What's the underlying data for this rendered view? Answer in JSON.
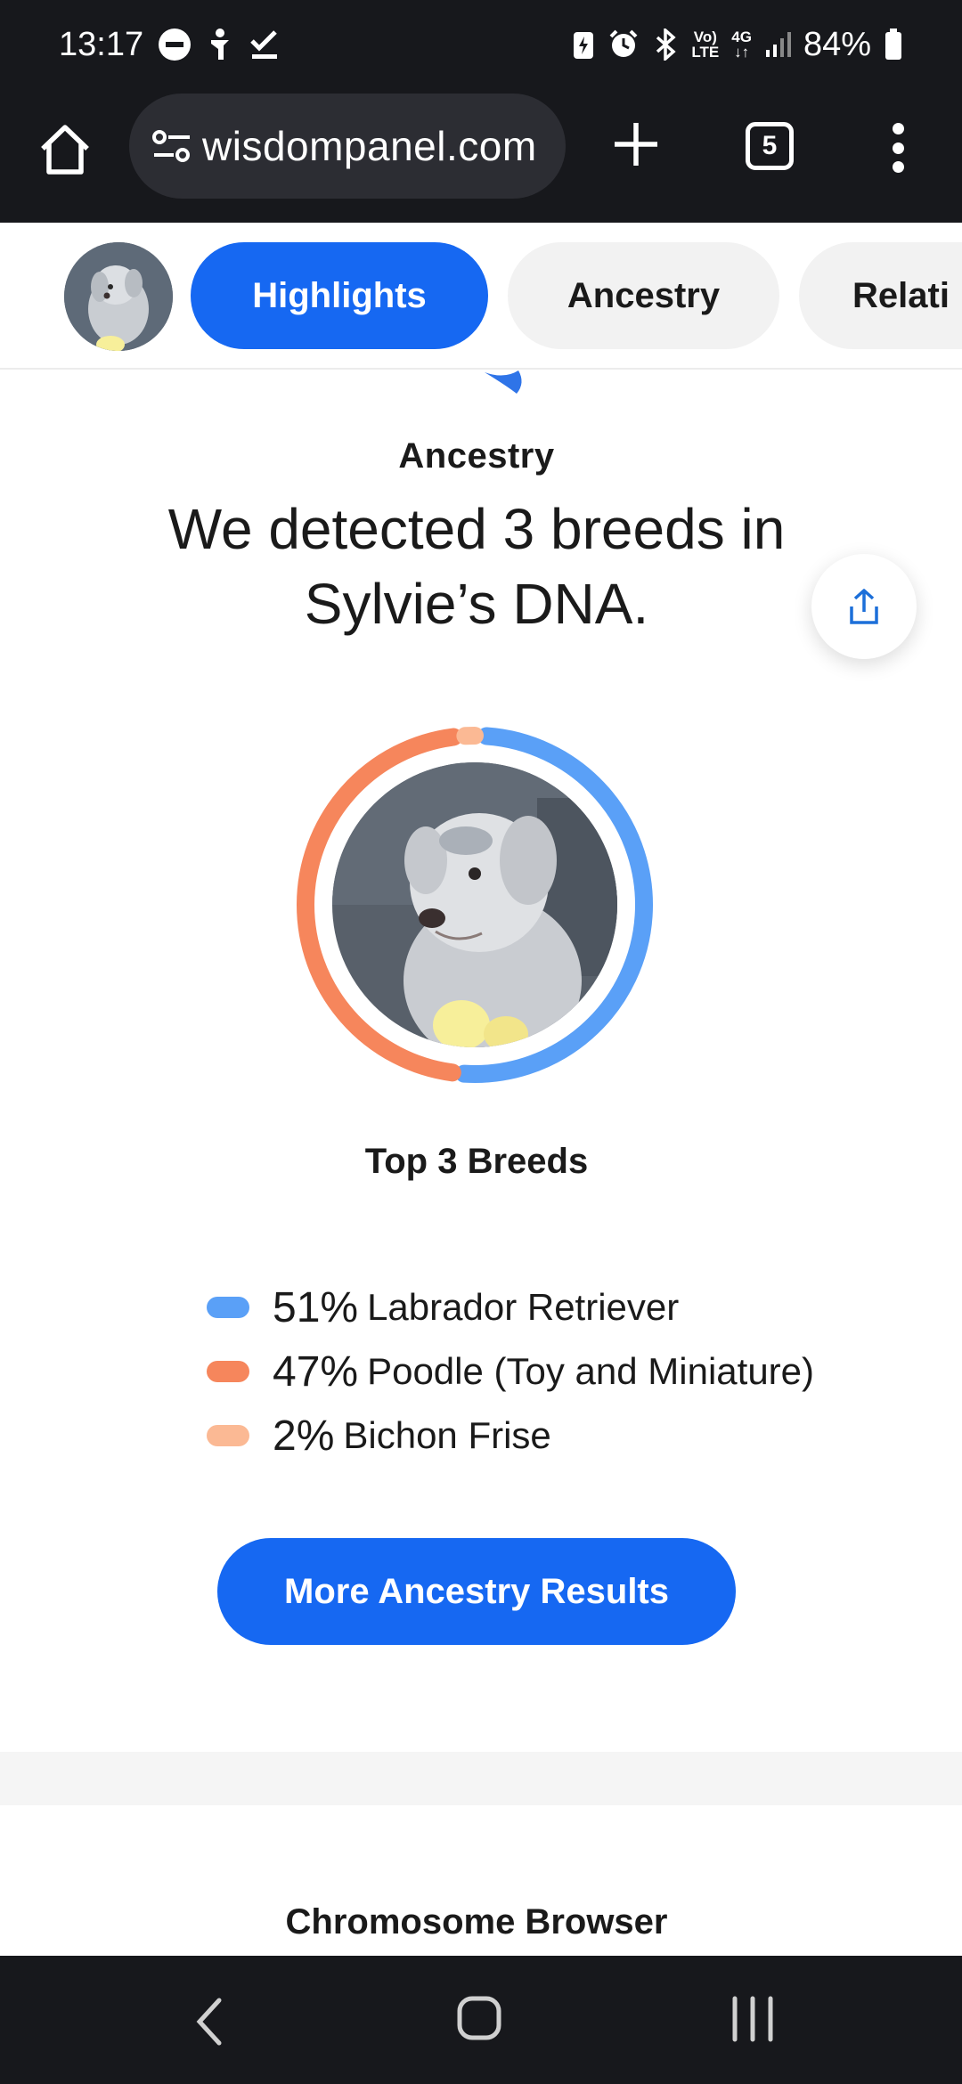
{
  "status_bar": {
    "time": "13:17",
    "battery": "84%",
    "network_top": "Vo)",
    "network_bottom": "LTE",
    "signal_top": "4G",
    "signal_bottom": "↓↑"
  },
  "browser": {
    "url": "wisdompanel.com",
    "tab_count": "5"
  },
  "tabs": [
    {
      "label": "Highlights",
      "active": true
    },
    {
      "label": "Ancestry",
      "active": false
    },
    {
      "label": "Relati",
      "active": false
    }
  ],
  "ancestry": {
    "section_label": "Ancestry",
    "headline_line1": "We detected 3 breeds in",
    "headline_line2": "Sylvie’s DNA.",
    "top_breeds_title": "Top 3 Breeds",
    "cta_label": "More Ancestry Results"
  },
  "chart_data": {
    "type": "pie",
    "variant": "donut",
    "title": "",
    "categories": [
      "Labrador Retriever",
      "Poodle (Toy and Miniature)",
      "Bichon Frise"
    ],
    "values": [
      51,
      47,
      2
    ],
    "unit": "%",
    "colors": [
      "#5aa0f7",
      "#f6865c",
      "#fbb994"
    ]
  },
  "legend": [
    {
      "pct": "51%",
      "name": "Labrador Retriever",
      "color": "#5aa0f7"
    },
    {
      "pct": "47%",
      "name": "Poodle (Toy and Miniature)",
      "color": "#f6865c"
    },
    {
      "pct": "2%",
      "name": "Bichon Frise",
      "color": "#fbb994"
    }
  ],
  "next_section": {
    "title": "Chromosome Browser"
  },
  "colors": {
    "accent": "#1668f2",
    "system_bar": "#17181c"
  }
}
